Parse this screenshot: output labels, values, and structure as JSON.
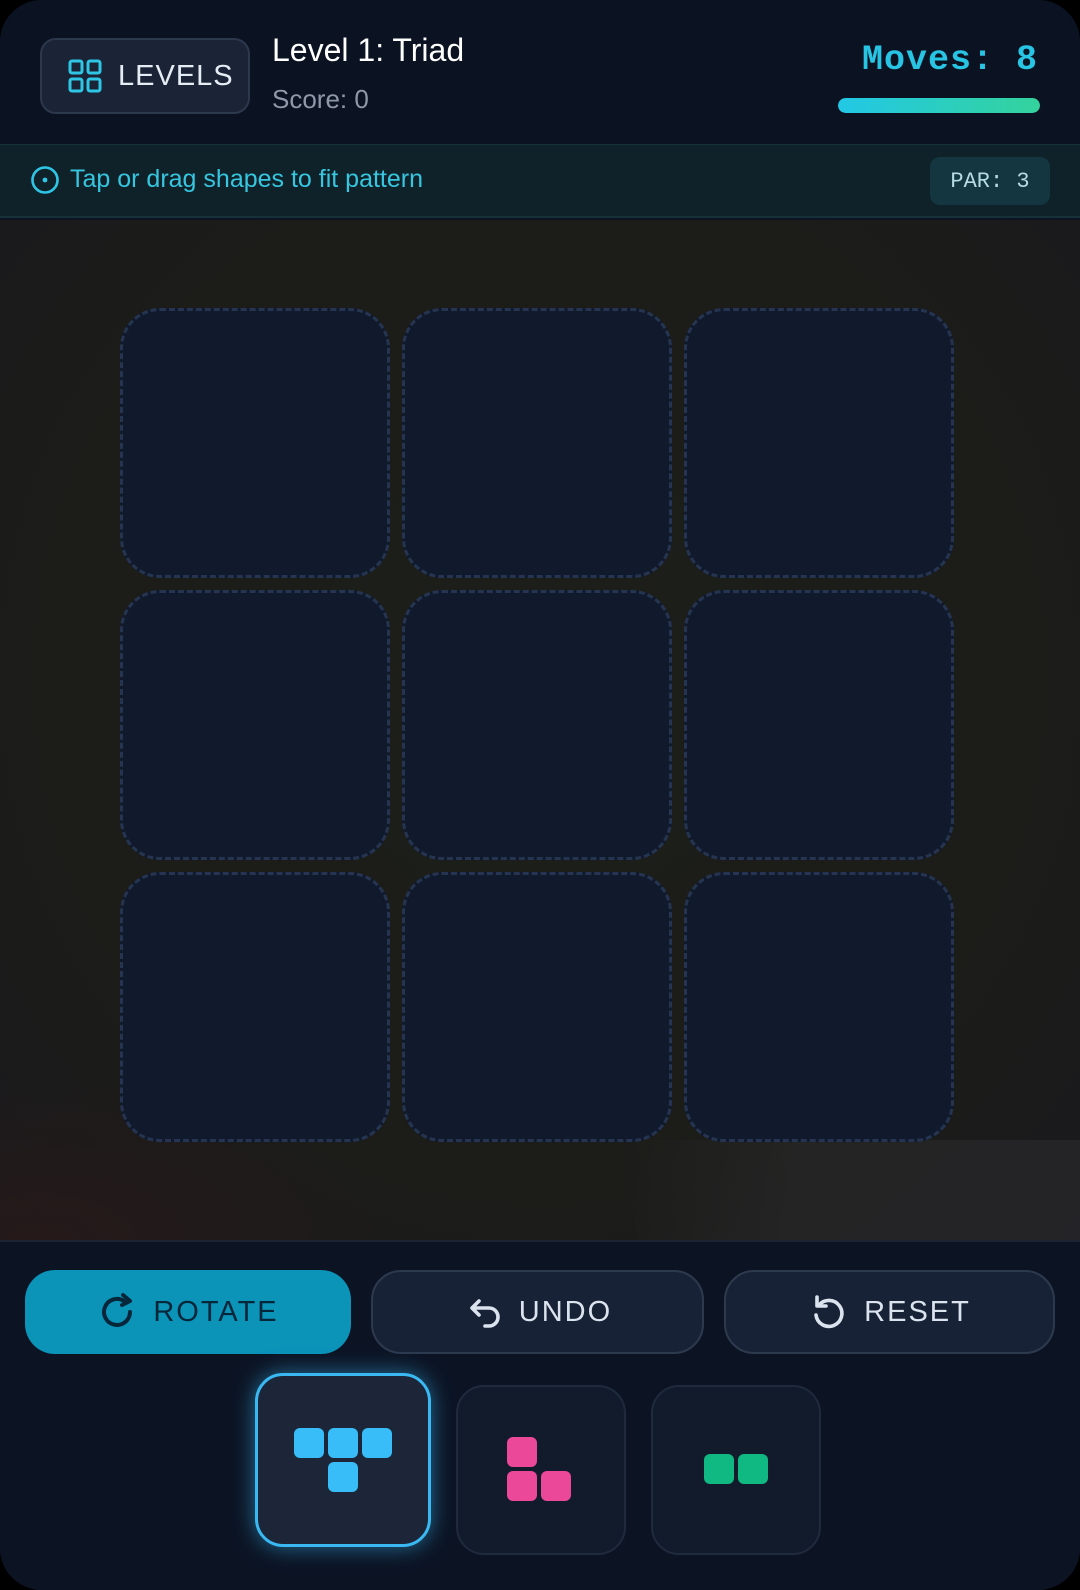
{
  "header": {
    "levels_label": "LEVELS",
    "level_title": "Level 1: Triad",
    "score_text": "Score: 0",
    "moves_text": "Moves: 8",
    "moves_progress": 1.0
  },
  "hint": {
    "text": "Tap or drag shapes to fit pattern",
    "par_text": "PAR: 3"
  },
  "board": {
    "rows": 3,
    "cols": 3,
    "cells": [
      "empty",
      "empty",
      "empty",
      "empty",
      "empty",
      "empty",
      "empty",
      "empty",
      "empty"
    ]
  },
  "actions": {
    "rotate_label": "ROTATE",
    "undo_label": "UNDO",
    "reset_label": "RESET"
  },
  "pieces": [
    {
      "shape": "T-tetromino",
      "color": "#38bdf8",
      "selected": true
    },
    {
      "shape": "L-tromino",
      "color": "#ec4899",
      "selected": false
    },
    {
      "shape": "domino",
      "color": "#10b981",
      "selected": false
    }
  ],
  "colors": {
    "accent": "#28c4e4",
    "rotate_button": "#0b93b8",
    "progress_start": "#22c8e6",
    "progress_end": "#34d39c"
  },
  "icons": {
    "levels": "grid-icon",
    "hint": "info-icon",
    "rotate": "rotate-clockwise-icon",
    "undo": "undo-icon",
    "reset": "reset-icon"
  }
}
